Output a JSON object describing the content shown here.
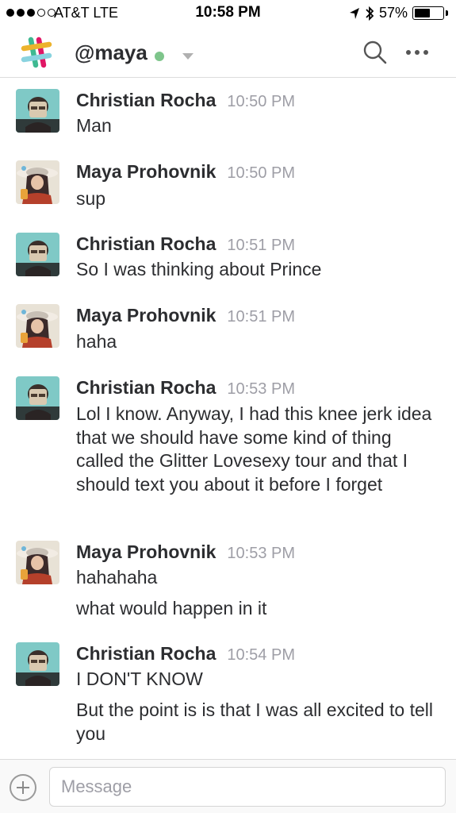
{
  "status_bar": {
    "carrier": "AT&T  LTE",
    "time": "10:58 PM",
    "battery": "57%",
    "battery_level": 0.57,
    "signal_bars_filled": 3,
    "signal_bars_total": 5,
    "icons": [
      "location-arrow-icon",
      "bluetooth-icon",
      "battery-icon"
    ]
  },
  "header": {
    "title": "@maya",
    "presence": "active",
    "presence_color": "#7ec58b",
    "logo": "slack-logo",
    "actions": [
      "search-icon",
      "more-icon"
    ]
  },
  "messages": [
    {
      "author": "Christian Rocha",
      "time": "10:50 PM",
      "avatar": "christian",
      "lines": [
        "Man"
      ]
    },
    {
      "author": "Maya Prohovnik",
      "time": "10:50 PM",
      "avatar": "maya",
      "lines": [
        "sup"
      ]
    },
    {
      "author": "Christian Rocha",
      "time": "10:51 PM",
      "avatar": "christian",
      "lines": [
        "So I was thinking about Prince"
      ]
    },
    {
      "author": "Maya Prohovnik",
      "time": "10:51 PM",
      "avatar": "maya",
      "lines": [
        "haha"
      ]
    },
    {
      "author": "Christian Rocha",
      "time": "10:53 PM",
      "avatar": "christian",
      "lines": [
        "Lol I know. Anyway, I had this knee jerk idea that we should have some kind of thing called the Glitter Lovesexy tour and that I should text you about it before I forget"
      ]
    },
    {
      "author": "Maya Prohovnik",
      "time": "10:53 PM",
      "avatar": "maya",
      "lines": [
        "hahahaha",
        "what would happen in it"
      ]
    },
    {
      "author": "Christian Rocha",
      "time": "10:54 PM",
      "avatar": "christian",
      "lines": [
        "I DON'T KNOW",
        "But the point is is that I was all excited to tell you"
      ]
    }
  ],
  "composer": {
    "placeholder": "Message",
    "value": ""
  }
}
